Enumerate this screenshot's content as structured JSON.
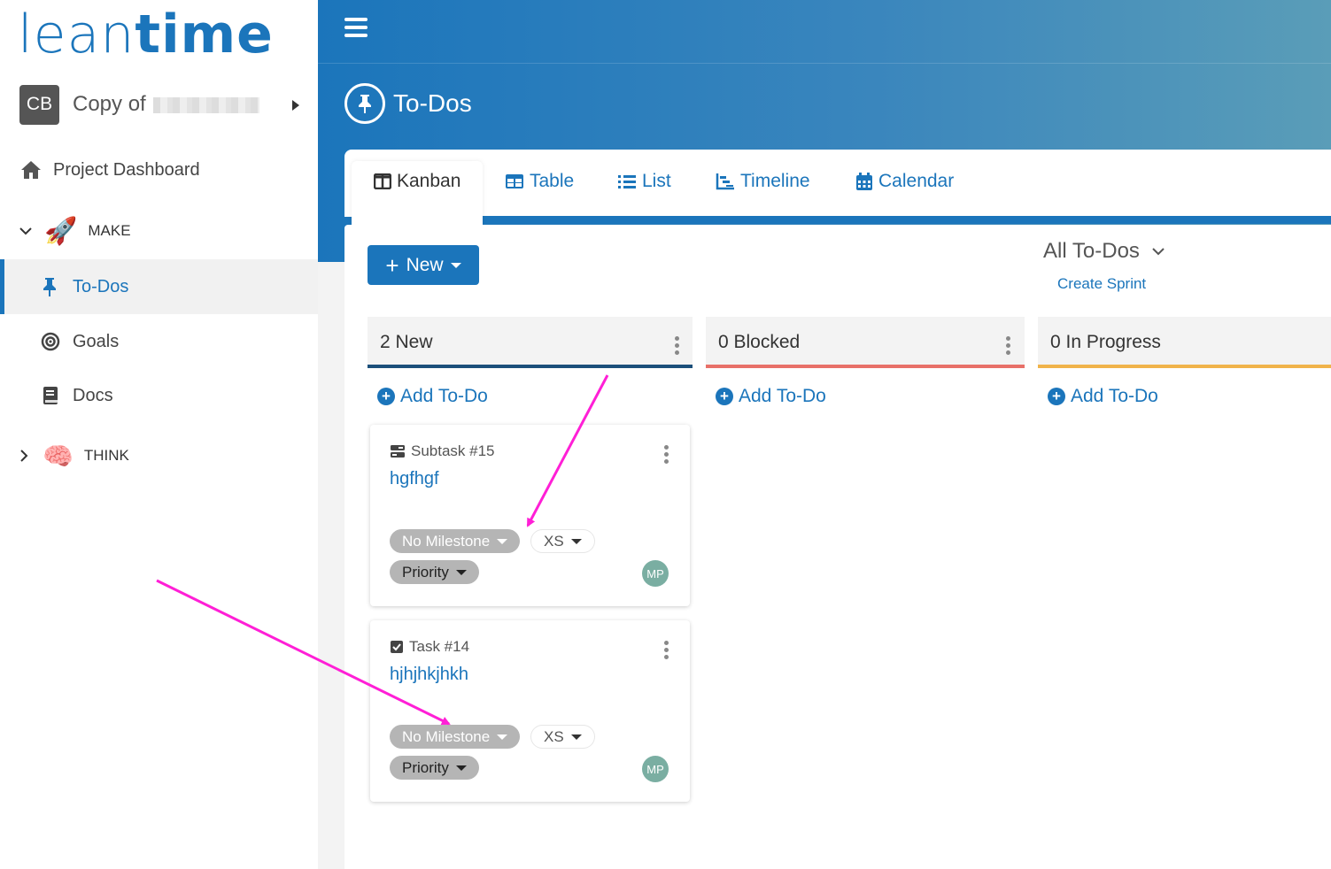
{
  "logo": {
    "part1": "lean",
    "part2": "time"
  },
  "project": {
    "initials": "CB",
    "name": "Copy of"
  },
  "sidebar": {
    "dashboard": "Project Dashboard",
    "make": "MAKE",
    "todos": "To-Dos",
    "goals": "Goals",
    "docs": "Docs",
    "think": "THINK"
  },
  "header": {
    "title": "To-Dos"
  },
  "tabs": [
    {
      "label": "Kanban"
    },
    {
      "label": "Table"
    },
    {
      "label": "List"
    },
    {
      "label": "Timeline"
    },
    {
      "label": "Calendar"
    }
  ],
  "toolbar": {
    "new_label": "New",
    "filter_label": "All To-Dos",
    "create_sprint": "Create Sprint"
  },
  "columns": [
    {
      "title": "2 New",
      "color": "#1b4f7a",
      "add": "Add To-Do"
    },
    {
      "title": "0 Blocked",
      "color": "#e87068",
      "add": "Add To-Do"
    },
    {
      "title": "0 In Progress",
      "color": "#f0b34a",
      "add": "Add To-Do"
    }
  ],
  "cards": [
    {
      "type": "Subtask #15",
      "title": "hgfhgf",
      "milestone": "No Milestone",
      "effort": "XS",
      "priority": "Priority",
      "assignee": "MP"
    },
    {
      "type": "Task #14",
      "title": "hjhjhkjhkh",
      "milestone": "No Milestone",
      "effort": "XS",
      "priority": "Priority",
      "assignee": "MP"
    }
  ],
  "colors": {
    "accent": "#1b75bb",
    "annotation": "#ff1fd6"
  }
}
